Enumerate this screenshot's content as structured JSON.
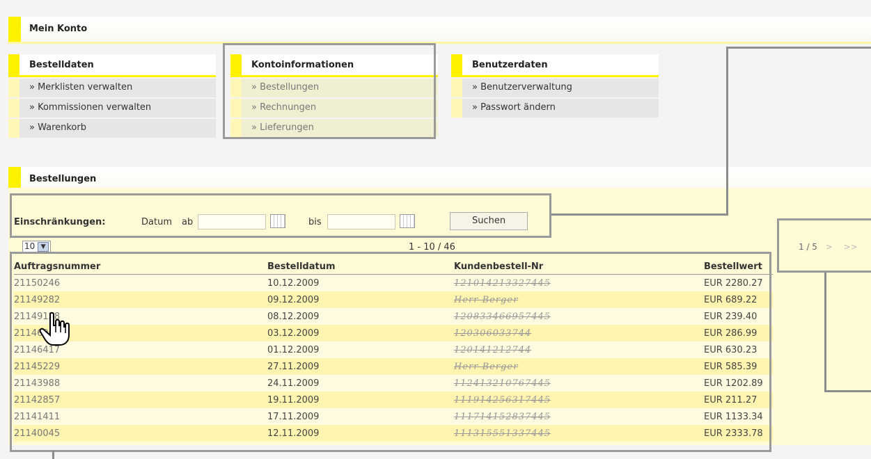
{
  "account": {
    "title": "Mein Konto"
  },
  "menu": {
    "columns": [
      {
        "title": "Bestelldaten",
        "items": [
          "» Merklisten verwalten",
          "» Kommissionen verwalten",
          "» Warenkorb"
        ]
      },
      {
        "title": "Kontoinformationen",
        "items": [
          "» Bestellungen",
          "» Rechnungen",
          "» Lieferungen"
        ]
      },
      {
        "title": "Benutzerdaten",
        "items": [
          "» Benutzerverwaltung",
          "» Passwort ändern"
        ]
      }
    ]
  },
  "orders": {
    "title": "Bestellungen",
    "filter": {
      "label": "Einschränkungen:",
      "date_label": "Datum",
      "from_label": "ab",
      "to_label": "bis",
      "from_value": "",
      "to_value": "",
      "search_button": "Suchen"
    },
    "page_size": "10",
    "range": "1 - 10 / 46",
    "pagination": {
      "current": "1 / 5",
      "next": ">",
      "last": ">>"
    },
    "columns": [
      "Auftragsnummer",
      "Bestelldatum",
      "Kundenbestell-Nr",
      "Bestellwert"
    ],
    "rows": [
      {
        "id": "21150246",
        "date": "10.12.2009",
        "ref": "121014213327445",
        "value": "EUR 2280.27"
      },
      {
        "id": "21149282",
        "date": "09.12.2009",
        "ref": "Herr Berger",
        "value": "EUR 689.22"
      },
      {
        "id": "21149128",
        "date": "08.12.2009",
        "ref": "120833466957445",
        "value": "EUR 239.40"
      },
      {
        "id": "21146966",
        "date": "03.12.2009",
        "ref": "120306033744",
        "value": "EUR 286.99"
      },
      {
        "id": "21146417",
        "date": "01.12.2009",
        "ref": "120141212744",
        "value": "EUR 630.23"
      },
      {
        "id": "21145229",
        "date": "27.11.2009",
        "ref": "Herr Berger",
        "value": "EUR 585.39"
      },
      {
        "id": "21143988",
        "date": "24.11.2009",
        "ref": "112413210767445",
        "value": "EUR 1202.89"
      },
      {
        "id": "21142857",
        "date": "19.11.2009",
        "ref": "111914256317445",
        "value": "EUR 211.27"
      },
      {
        "id": "21141411",
        "date": "17.11.2009",
        "ref": "111714152837445",
        "value": "EUR 1133.34"
      },
      {
        "id": "21140045",
        "date": "12.11.2009",
        "ref": "111315551337445",
        "value": "EUR 2333.78"
      }
    ]
  }
}
